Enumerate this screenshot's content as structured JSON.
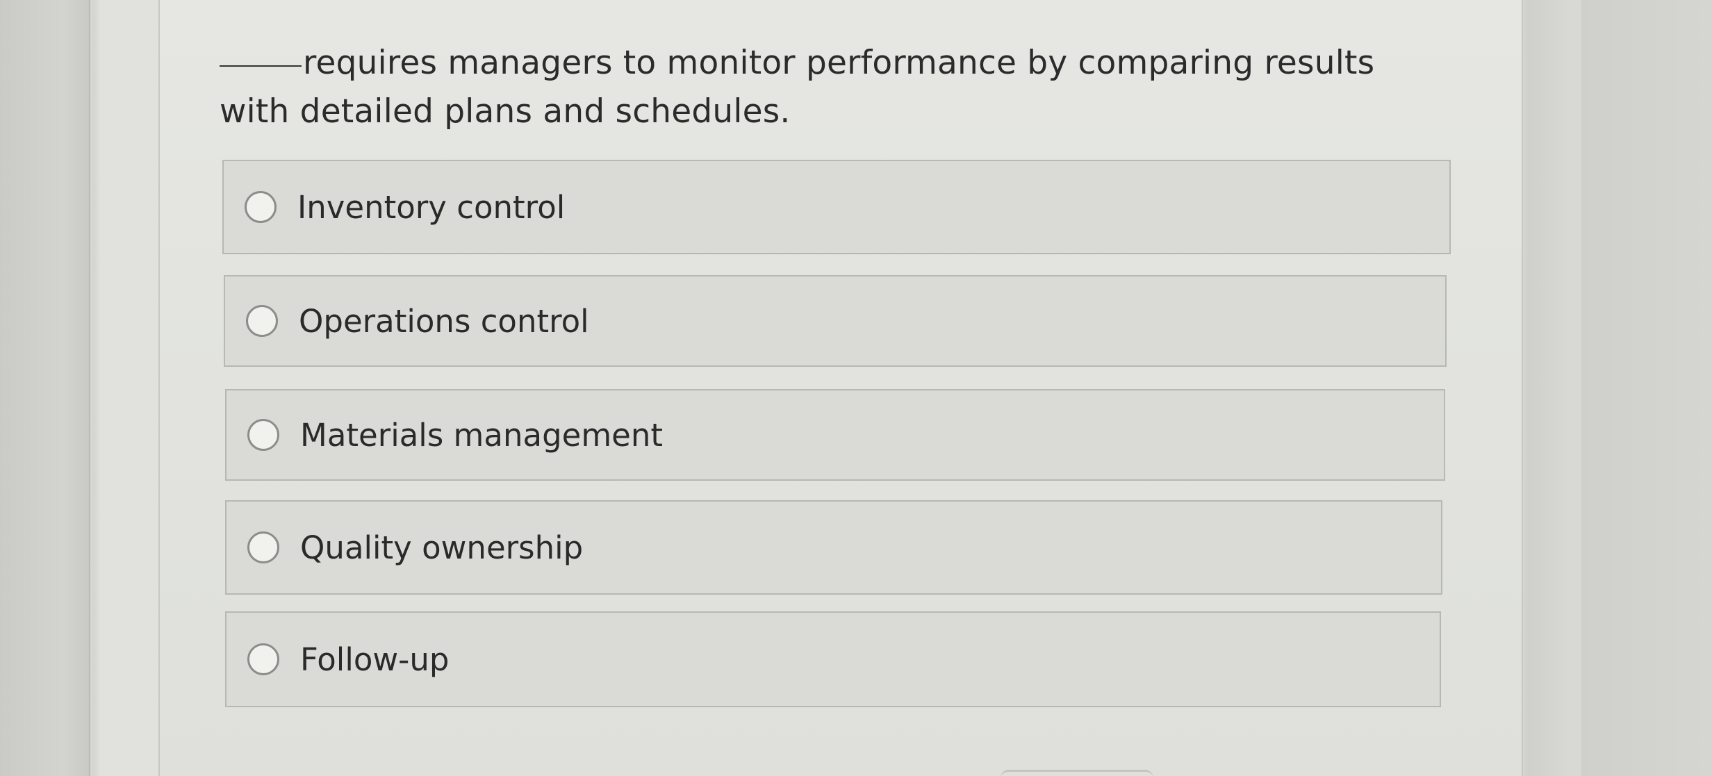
{
  "question": {
    "blank": "",
    "text": "requires managers to monitor performance by comparing results with detailed plans and schedules."
  },
  "options": [
    {
      "label": "Inventory control",
      "selected": false
    },
    {
      "label": "Operations control",
      "selected": false
    },
    {
      "label": "Materials management",
      "selected": false
    },
    {
      "label": "Quality ownership",
      "selected": false
    },
    {
      "label": "Follow-up",
      "selected": false
    }
  ]
}
